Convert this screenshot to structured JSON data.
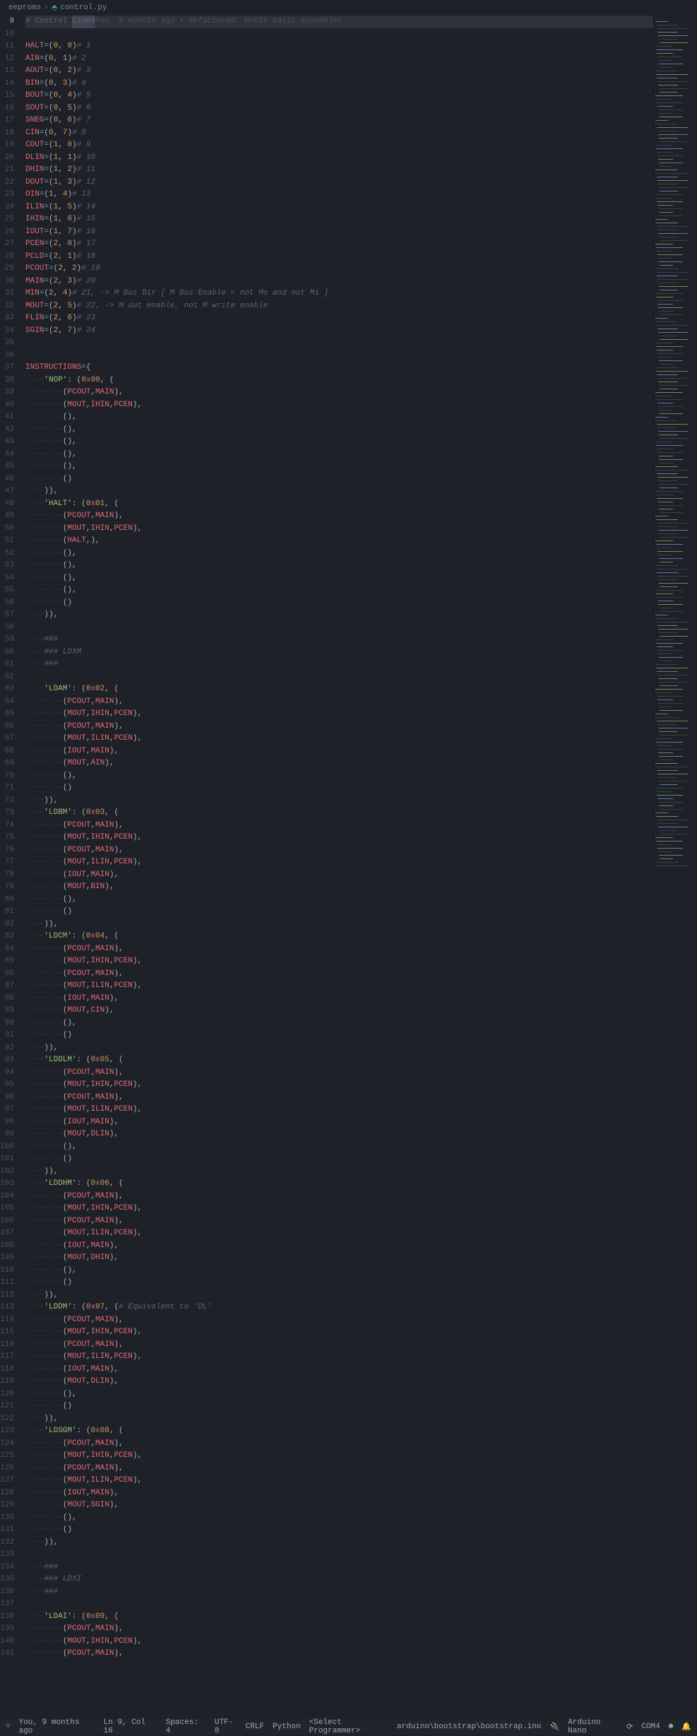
{
  "breadcrumb": {
    "folder": "eeproms",
    "file": "control.py"
  },
  "blame": "You, 9 months ago • Refactored, Wrote basic assembler",
  "active_line": 9,
  "selection_text": "Lines",
  "comment_prefix": "# Control ",
  "signals": [
    {
      "ln": 11,
      "name": "HALT",
      "v": "(0, 0)",
      "c": "# 1"
    },
    {
      "ln": 12,
      "name": "AIN",
      "v": "(0, 1)",
      "c": "# 2"
    },
    {
      "ln": 13,
      "name": "AOUT",
      "v": "(0, 2)",
      "c": "# 3"
    },
    {
      "ln": 14,
      "name": "BIN",
      "v": "(0, 3)",
      "c": "# 4"
    },
    {
      "ln": 15,
      "name": "BOUT",
      "v": "(0, 4)",
      "c": "# 5"
    },
    {
      "ln": 16,
      "name": "SOUT",
      "v": "(0, 5)",
      "c": "# 6"
    },
    {
      "ln": 17,
      "name": "SNEG",
      "v": "(0, 6)",
      "c": "# 7"
    },
    {
      "ln": 18,
      "name": "CIN",
      "v": "(0, 7)",
      "c": "# 8"
    },
    {
      "ln": 19,
      "name": "COUT",
      "v": "(1, 0)",
      "c": "# 9"
    },
    {
      "ln": 20,
      "name": "DLIN",
      "v": "(1, 1)",
      "c": "# 10"
    },
    {
      "ln": 21,
      "name": "DHIN",
      "v": "(1, 2)",
      "c": "# 11"
    },
    {
      "ln": 22,
      "name": "DOUT",
      "v": "(1, 3)",
      "c": "# 12"
    },
    {
      "ln": 23,
      "name": "OIN",
      "v": "(1, 4)",
      "c": "# 13"
    },
    {
      "ln": 24,
      "name": "ILIN",
      "v": "(1, 5)",
      "c": "# 14"
    },
    {
      "ln": 25,
      "name": "IHIN",
      "v": "(1, 6)",
      "c": "# 15"
    },
    {
      "ln": 26,
      "name": "IOUT",
      "v": "(1, 7)",
      "c": "# 16"
    },
    {
      "ln": 27,
      "name": "PCEN",
      "v": "(2, 0)",
      "c": "# 17"
    },
    {
      "ln": 28,
      "name": "PCLD",
      "v": "(2, 1)",
      "c": "# 18"
    },
    {
      "ln": 29,
      "name": "PCOUT",
      "v": "(2, 2)",
      "c": "# 19"
    },
    {
      "ln": 30,
      "name": "MAIN",
      "v": "(2, 3)",
      "c": "# 20"
    },
    {
      "ln": 31,
      "name": "MIN",
      "v": "(2, 4)",
      "c": "# 21, -> M Bus Dir [ M Bus Enable = not Mo and not Mi ]"
    },
    {
      "ln": 32,
      "name": "MOUT",
      "v": "(2, 5)",
      "c": "# 22, -> M out enable, not M write enable"
    },
    {
      "ln": 33,
      "name": "FLIN",
      "v": "(2, 6)",
      "c": "# 23"
    },
    {
      "ln": 34,
      "name": "SGIN",
      "v": "(2, 7)",
      "c": "# 24"
    }
  ],
  "instr_header": {
    "ln": 37,
    "text": "INSTRUCTIONS = {"
  },
  "instructions": [
    {
      "name": "NOP",
      "hex": "0x00",
      "start": 38,
      "steps": [
        "(PCOUT, MAIN),",
        "(MOUT, IHIN, PCEN),",
        "(),",
        "(),",
        "(),",
        "(),",
        "(),",
        "()"
      ],
      "close": ")),"
    },
    {
      "name": "HALT",
      "hex": "0x01",
      "start": 48,
      "steps": [
        "(PCOUT, MAIN),",
        "(MOUT, IHIN, PCEN),",
        "(HALT,),",
        "(),",
        "(),",
        "(),",
        "(),",
        "()"
      ],
      "close": ")),"
    },
    {
      "sep": [
        "###",
        "### LDXM",
        "###"
      ],
      "sep_start": 59
    },
    {
      "name": "LDAM",
      "hex": "0x02",
      "start": 63,
      "steps": [
        "(PCOUT, MAIN),",
        "(MOUT, IHIN, PCEN),",
        "(PCOUT, MAIN),",
        "(MOUT, ILIN, PCEN),",
        "(IOUT, MAIN),",
        "(MOUT, AIN),",
        "(),",
        "()"
      ],
      "close": ")),"
    },
    {
      "name": "LDBM",
      "hex": "0x03",
      "start": 73,
      "steps": [
        "(PCOUT, MAIN),",
        "(MOUT, IHIN, PCEN),",
        "(PCOUT, MAIN),",
        "(MOUT, ILIN, PCEN),",
        "(IOUT, MAIN),",
        "(MOUT, BIN),",
        "(),",
        "()"
      ],
      "close": ")),"
    },
    {
      "name": "LDCM",
      "hex": "0x04",
      "start": 83,
      "steps": [
        "(PCOUT, MAIN),",
        "(MOUT, IHIN, PCEN),",
        "(PCOUT, MAIN),",
        "(MOUT, ILIN, PCEN),",
        "(IOUT, MAIN),",
        "(MOUT, CIN),",
        "(),",
        "()"
      ],
      "close": ")),"
    },
    {
      "name": "LDDLM",
      "hex": "0x05",
      "start": 93,
      "steps": [
        "(PCOUT, MAIN),",
        "(MOUT, IHIN, PCEN),",
        "(PCOUT, MAIN),",
        "(MOUT, ILIN, PCEN),",
        "(IOUT, MAIN),",
        "(MOUT, DLIN),",
        "(),",
        "()"
      ],
      "close": ")),"
    },
    {
      "name": "LDDHM",
      "hex": "0x06",
      "start": 103,
      "steps": [
        "(PCOUT, MAIN),",
        "(MOUT, IHIN, PCEN),",
        "(PCOUT, MAIN),",
        "(MOUT, ILIN, PCEN),",
        "(IOUT, MAIN),",
        "(MOUT, DHIN),",
        "(),",
        "()"
      ],
      "close": ")),"
    },
    {
      "name": "LDDM",
      "hex": "0x07",
      "start": 113,
      "trail": " # Equivalent to 'DL'",
      "steps": [
        "(PCOUT, MAIN),",
        "(MOUT, IHIN, PCEN),",
        "(PCOUT, MAIN),",
        "(MOUT, ILIN, PCEN),",
        "(IOUT, MAIN),",
        "(MOUT, DLIN),",
        "(),",
        "()"
      ],
      "close": ")),"
    },
    {
      "name": "LDSGM",
      "hex": "0x08",
      "start": 123,
      "steps": [
        "(PCOUT, MAIN),",
        "(MOUT, IHIN, PCEN),",
        "(PCOUT, MAIN),",
        "(MOUT, ILIN, PCEN),",
        "(IOUT, MAIN),",
        "(MOUT, SGIN),",
        "(),",
        "()"
      ],
      "close": ")),"
    },
    {
      "sep": [
        "###",
        "### LDXI",
        "###"
      ],
      "sep_start": 134
    },
    {
      "name": "LDAI",
      "hex": "0x09",
      "start": 138,
      "steps": [
        "(PCOUT, MAIN),",
        "(MOUT, IHIN, PCEN),",
        "(PCOUT, MAIN),"
      ],
      "partial": true
    }
  ],
  "statusbar": {
    "blame": "You, 9 months ago",
    "cursor": "Ln 9, Col 16",
    "spaces": "Spaces: 4",
    "encoding": "UTF-8",
    "eol": "CRLF",
    "lang": "Python",
    "programmer": "<Select Programmer>",
    "sketch": "arduino\\bootstrap\\bootstrap.ino",
    "board": "Arduino Nano",
    "port": "COM4"
  }
}
